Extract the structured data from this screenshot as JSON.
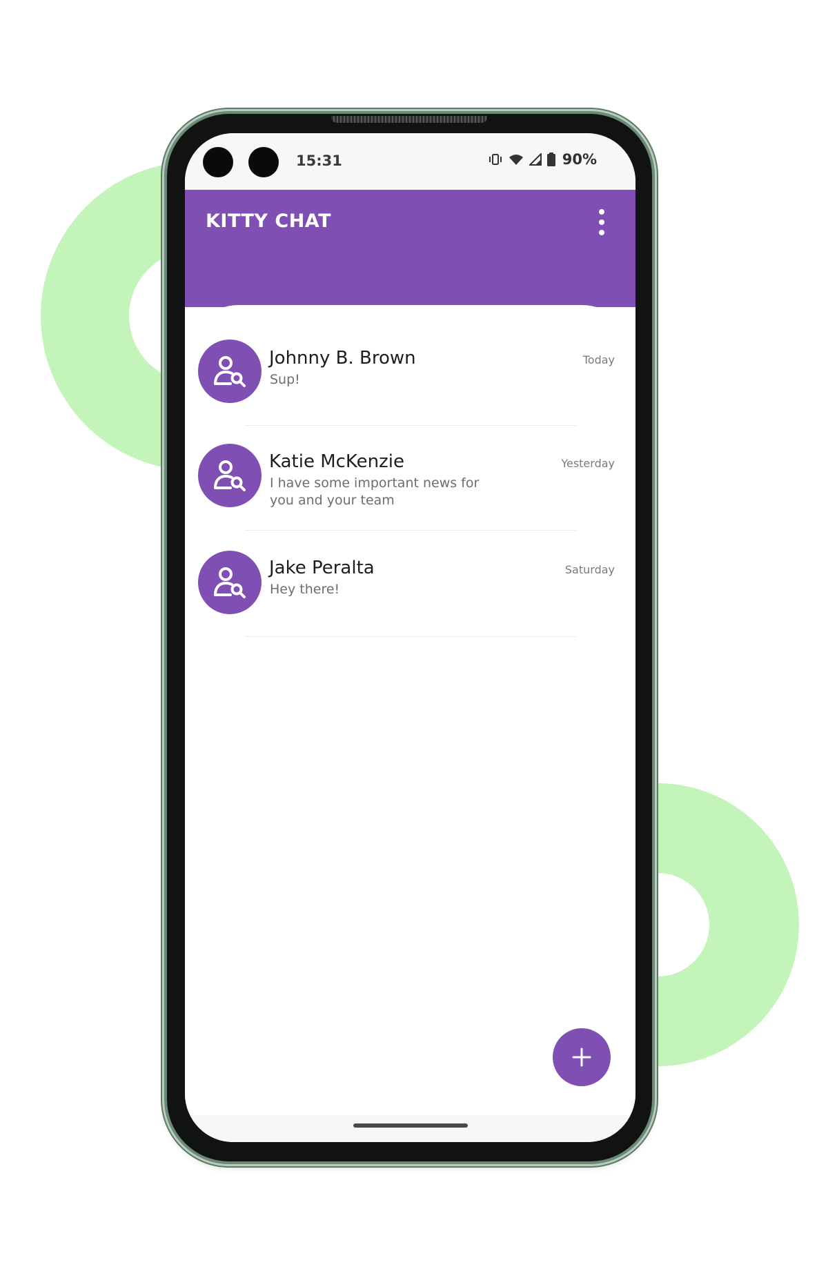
{
  "colors": {
    "accent": "#7f4fb3",
    "decor_ring": "#c3f4ba",
    "screen_bg": "#ffffff",
    "status_bar_bg": "#f7f7f9"
  },
  "status_bar": {
    "time": "15:31",
    "battery_percent": "90%",
    "icons": [
      "vibrate-icon",
      "wifi-icon",
      "signal-icon",
      "battery-icon"
    ]
  },
  "app_bar": {
    "title": "KITTY CHAT",
    "menu_icon": "more-vertical-icon"
  },
  "chats": [
    {
      "name": "Johnny B. Brown",
      "message": "Sup!",
      "time": "Today",
      "avatar_icon": "user-search-icon"
    },
    {
      "name": "Katie McKenzie",
      "message": "I have some important news for you and your team",
      "time": "Yesterday",
      "avatar_icon": "user-search-icon"
    },
    {
      "name": "Jake Peralta",
      "message": "Hey there!",
      "time": "Saturday",
      "avatar_icon": "user-search-icon"
    }
  ],
  "fab": {
    "icon": "plus-icon"
  }
}
